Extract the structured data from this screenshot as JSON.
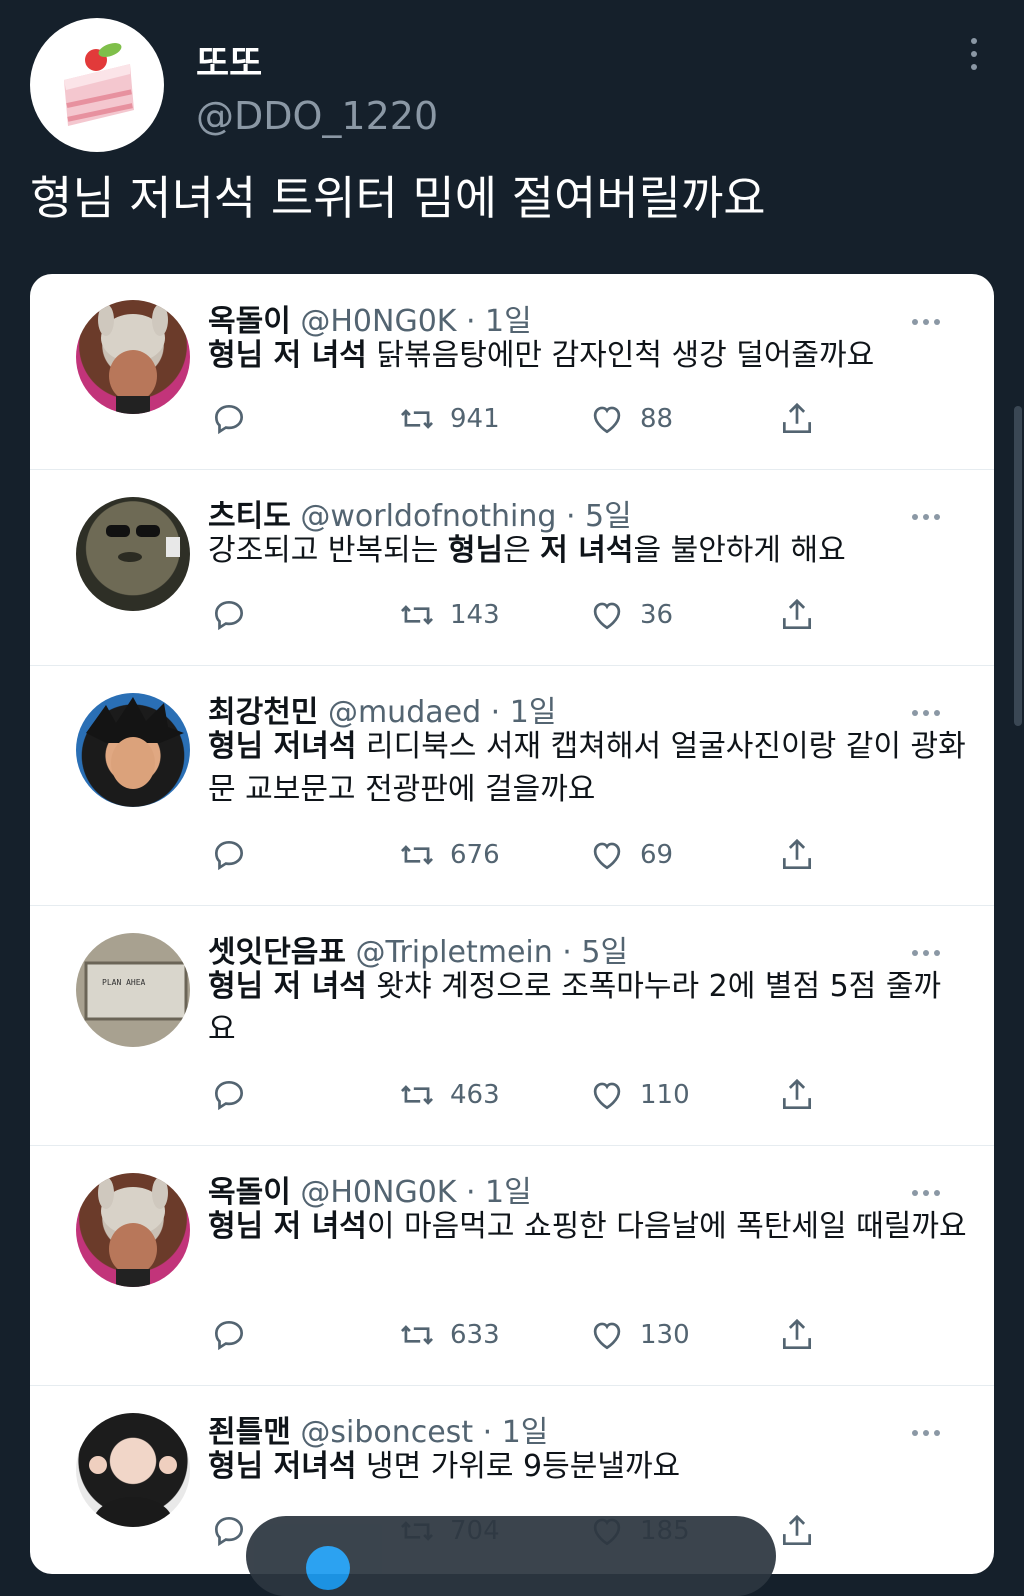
{
  "post": {
    "display_name": "또또",
    "handle": "@DDO_1220",
    "text": "형님 저녀석 트위터 밈에 절여버릴까요",
    "more_icon": "more-vertical-icon"
  },
  "tweets": [
    {
      "name": "옥돌이",
      "meta": "@H0NG0K · 1일",
      "body_bold": "형님 저 녀석",
      "body_rest": " 닭볶음탕에만 감자인척 생강 덜어줄까요",
      "replies": "",
      "retweets": "941",
      "likes": "88"
    },
    {
      "name": "츠티도",
      "meta": "@worldofnothing · 5일",
      "body_pre": "강조되고 반복되는 ",
      "body_bold": "형님",
      "body_mid": "은 ",
      "body_bold2": "저 녀석",
      "body_rest": "을 불안하게 해요",
      "retweets": "143",
      "likes": "36"
    },
    {
      "name": "최강천민",
      "meta": "@mudaed · 1일",
      "body_bold": "형님 저녀석",
      "body_rest": " 리디북스 서재 캡쳐해서 얼굴사진이랑 같이 광화문 교보문고 전광판에 걸을까요",
      "retweets": "676",
      "likes": "69"
    },
    {
      "name": "셋잇단음표",
      "meta": "@Tripletmein · 5일",
      "body_bold": "형님 저 녀석",
      "body_rest": " 왓챠 계정으로 조폭마누라 2에 별점 5점 줄까요",
      "retweets": "463",
      "likes": "110",
      "avatar_text": "PLAN AHEA"
    },
    {
      "name": "옥돌이",
      "meta": "@H0NG0K · 1일",
      "body_bold": "형님 저 녀석",
      "body_rest": "이 마음먹고 쇼핑한 다음날에 폭탄세일 때릴까요",
      "retweets": "633",
      "likes": "130"
    },
    {
      "name": "죈틀맨",
      "meta": "@siboncest · 1일",
      "body_bold": "형님 저녀석",
      "body_rest": " 냉면 가위로 9등분낼까요",
      "retweets": "704",
      "likes": "185"
    }
  ],
  "icons": {
    "reply": "reply-icon",
    "retweet": "retweet-icon",
    "like": "heart-icon",
    "share": "share-icon",
    "more": "more-horizontal-icon"
  },
  "colors": {
    "background": "#15202b",
    "card": "#ffffff",
    "muted": "#536471"
  }
}
